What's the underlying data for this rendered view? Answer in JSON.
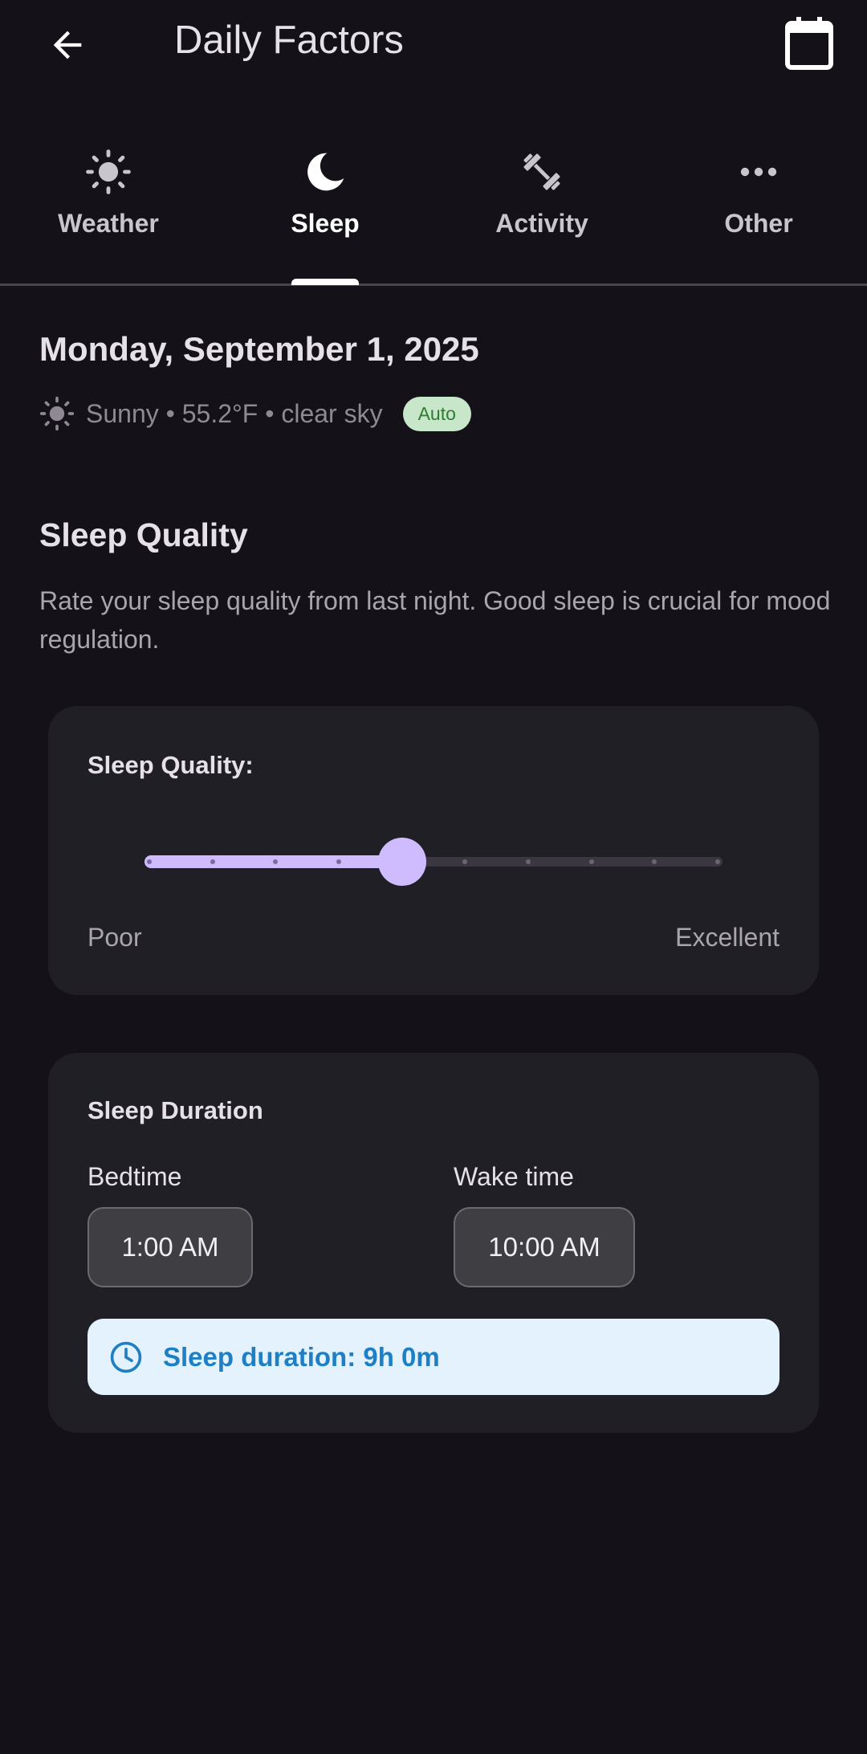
{
  "app_bar": {
    "title": "Daily Factors",
    "back_icon": "arrow-back-icon",
    "calendar_icon": "calendar-icon"
  },
  "tabs": [
    {
      "label": "Weather",
      "icon": "sun-icon",
      "active": false
    },
    {
      "label": "Sleep",
      "icon": "moon-icon",
      "active": true
    },
    {
      "label": "Activity",
      "icon": "dumbbell-icon",
      "active": false
    },
    {
      "label": "Other",
      "icon": "more-horiz-icon",
      "active": false
    }
  ],
  "date_title": "Monday, September 1, 2025",
  "weather_summary": {
    "icon": "sun-icon",
    "text": "Sunny • 55.2°F • clear sky",
    "chip": "Auto"
  },
  "section": {
    "title": "Sleep Quality",
    "description": "Rate your sleep quality from last night. Good sleep is crucial for mood regulation."
  },
  "quality_card": {
    "label": "Sleep Quality:",
    "slider": {
      "min": 1,
      "max": 10,
      "value": 5
    },
    "min_label": "Poor",
    "max_label": "Excellent"
  },
  "duration_card": {
    "title": "Sleep Duration",
    "bedtime_label": "Bedtime",
    "bedtime_value": "1:00 AM",
    "wake_label": "Wake time",
    "wake_value": "10:00 AM",
    "duration_text": "Sleep duration: 9h 0m",
    "duration_icon": "clock-icon"
  },
  "colors": {
    "background": "#141218",
    "card": "#211F26",
    "accent": "#CFBCFF",
    "chip_bg": "#C8E6C9",
    "chip_text": "#2E7D32",
    "info_bg": "#E3F2FD",
    "info_text": "#1E7FC4"
  }
}
